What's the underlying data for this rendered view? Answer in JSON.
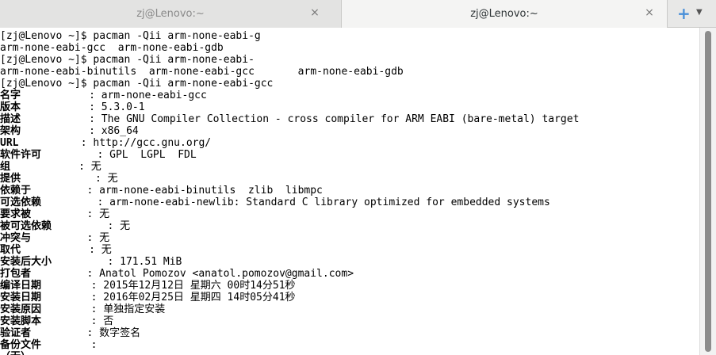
{
  "tabs": [
    {
      "title": "zj@Lenovo:~",
      "close": "×"
    },
    {
      "title": "zj@Lenovo:~",
      "close": "×"
    }
  ],
  "new_tab": {
    "plus": "+",
    "dropdown": "▼"
  },
  "prompt": "[zj@Lenovo ~]$ ",
  "commands": [
    {
      "cmd": "pacman -Qii arm-none-eabi-g",
      "output": [
        "arm-none-eabi-gcc  arm-none-eabi-gdb"
      ]
    },
    {
      "cmd": "pacman -Qii arm-none-eabi-",
      "output": [
        "arm-none-eabi-binutils  arm-none-eabi-gcc       arm-none-eabi-gdb"
      ]
    },
    {
      "cmd": "pacman -Qii arm-none-eabi-gcc",
      "output": []
    }
  ],
  "info": [
    {
      "key": "名字",
      "pad": "           ",
      "value": ": arm-none-eabi-gcc"
    },
    {
      "key": "版本",
      "pad": "           ",
      "value": ": 5.3.0-1"
    },
    {
      "key": "描述",
      "pad": "           ",
      "value": ": The GNU Compiler Collection - cross compiler for ARM EABI (bare-metal) target"
    },
    {
      "key": "架构",
      "pad": "           ",
      "value": ": x86_64"
    },
    {
      "key": "URL",
      "pad": "          ",
      "value": ": http://gcc.gnu.org/"
    },
    {
      "key": "软件许可",
      "pad": "         ",
      "value": ": GPL  LGPL  FDL"
    },
    {
      "key": "组",
      "pad": "           ",
      "value": ": 无"
    },
    {
      "key": "提供",
      "pad": "            ",
      "value": ": 无"
    },
    {
      "key": "依赖于",
      "pad": "         ",
      "value": ": arm-none-eabi-binutils  zlib  libmpc"
    },
    {
      "key": "可选依赖",
      "pad": "         ",
      "value": ": arm-none-eabi-newlib: Standard C library optimized for embedded systems"
    },
    {
      "key": "要求被",
      "pad": "         ",
      "value": ": 无"
    },
    {
      "key": "被可选依赖",
      "pad": "         ",
      "value": ": 无"
    },
    {
      "key": "冲突与",
      "pad": "         ",
      "value": ": 无"
    },
    {
      "key": "取代",
      "pad": "           ",
      "value": ": 无"
    },
    {
      "key": "安装后大小",
      "pad": "         ",
      "value": ": 171.51 MiB"
    },
    {
      "key": "打包者",
      "pad": "         ",
      "value": ": Anatol Pomozov <anatol.pomozov@gmail.com>"
    },
    {
      "key": "编译日期",
      "pad": "        ",
      "value": ": 2015年12月12日 星期六 00时14分51秒"
    },
    {
      "key": "安装日期",
      "pad": "        ",
      "value": ": 2016年02月25日 星期四 14时05分41秒"
    },
    {
      "key": "安装原因",
      "pad": "        ",
      "value": ": 单独指定安装"
    },
    {
      "key": "安装脚本",
      "pad": "        ",
      "value": ": 否"
    },
    {
      "key": "验证者",
      "pad": "         ",
      "value": ": 数字签名"
    },
    {
      "key": "备份文件",
      "pad": "        ",
      "value": ":"
    },
    {
      "key": "（无）",
      "pad": "",
      "value": ""
    }
  ]
}
